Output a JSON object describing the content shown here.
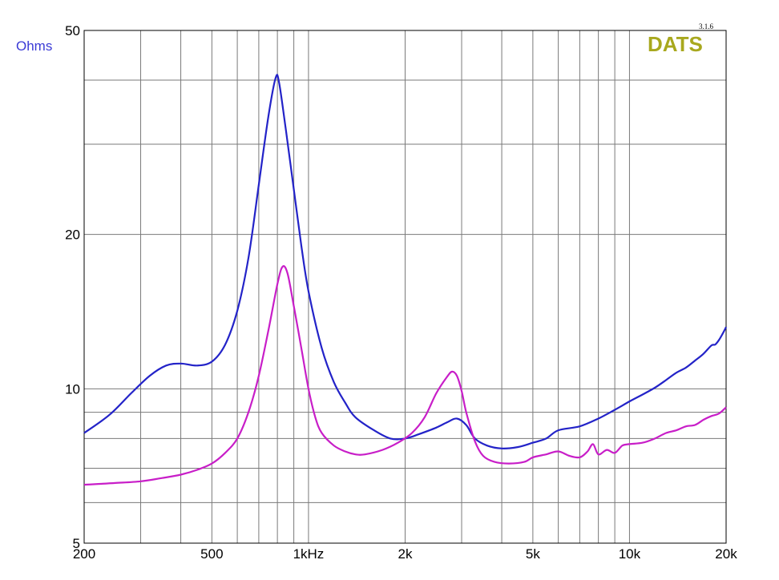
{
  "brand": {
    "name": "DATS",
    "version": "3.1.6"
  },
  "chart_data": {
    "type": "line",
    "title": "",
    "xlabel": "",
    "ylabel": "Ohms",
    "xscale": "log",
    "yscale": "log",
    "xlim": [
      200,
      20000
    ],
    "ylim": [
      5,
      50
    ],
    "grid": true,
    "x_tick_labels": [
      {
        "value": 200,
        "label": "200"
      },
      {
        "value": 500,
        "label": "500"
      },
      {
        "value": 1000,
        "label": "1kHz"
      },
      {
        "value": 2000,
        "label": "2k"
      },
      {
        "value": 5000,
        "label": "5k"
      },
      {
        "value": 10000,
        "label": "10k"
      },
      {
        "value": 20000,
        "label": "20k"
      }
    ],
    "y_tick_labels": [
      {
        "value": 5,
        "label": "5"
      },
      {
        "value": 10,
        "label": "10"
      },
      {
        "value": 20,
        "label": "20"
      },
      {
        "value": 50,
        "label": "50"
      }
    ],
    "series": [
      {
        "color": "#2323c8",
        "points": [
          [
            200,
            8.2
          ],
          [
            240,
            8.9
          ],
          [
            280,
            9.8
          ],
          [
            320,
            10.6
          ],
          [
            360,
            11.1
          ],
          [
            400,
            11.2
          ],
          [
            450,
            11.1
          ],
          [
            500,
            11.3
          ],
          [
            550,
            12.2
          ],
          [
            600,
            14.2
          ],
          [
            650,
            18.0
          ],
          [
            700,
            25.0
          ],
          [
            750,
            34.0
          ],
          [
            790,
            40.4
          ],
          [
            810,
            39.5
          ],
          [
            850,
            32.0
          ],
          [
            900,
            24.5
          ],
          [
            950,
            19.0
          ],
          [
            1000,
            15.5
          ],
          [
            1100,
            12.0
          ],
          [
            1200,
            10.3
          ],
          [
            1300,
            9.4
          ],
          [
            1400,
            8.8
          ],
          [
            1600,
            8.3
          ],
          [
            1800,
            8.0
          ],
          [
            2000,
            8.0
          ],
          [
            2200,
            8.15
          ],
          [
            2500,
            8.4
          ],
          [
            2700,
            8.6
          ],
          [
            2900,
            8.75
          ],
          [
            3100,
            8.5
          ],
          [
            3300,
            8.0
          ],
          [
            3600,
            7.75
          ],
          [
            4000,
            7.65
          ],
          [
            4500,
            7.7
          ],
          [
            5000,
            7.85
          ],
          [
            5500,
            8.0
          ],
          [
            6000,
            8.3
          ],
          [
            7000,
            8.45
          ],
          [
            8000,
            8.75
          ],
          [
            9000,
            9.1
          ],
          [
            10000,
            9.45
          ],
          [
            11000,
            9.75
          ],
          [
            12000,
            10.05
          ],
          [
            13000,
            10.4
          ],
          [
            14000,
            10.75
          ],
          [
            15000,
            11.0
          ],
          [
            16000,
            11.35
          ],
          [
            17000,
            11.7
          ],
          [
            18000,
            12.15
          ],
          [
            18500,
            12.2
          ],
          [
            19000,
            12.45
          ],
          [
            19500,
            12.8
          ],
          [
            20000,
            13.2
          ]
        ]
      },
      {
        "color": "#c81ec8",
        "points": [
          [
            200,
            6.5
          ],
          [
            250,
            6.55
          ],
          [
            300,
            6.6
          ],
          [
            350,
            6.7
          ],
          [
            400,
            6.8
          ],
          [
            450,
            6.95
          ],
          [
            500,
            7.15
          ],
          [
            550,
            7.5
          ],
          [
            600,
            8.0
          ],
          [
            650,
            9.0
          ],
          [
            700,
            10.6
          ],
          [
            750,
            13.0
          ],
          [
            800,
            16.0
          ],
          [
            830,
            17.3
          ],
          [
            860,
            16.8
          ],
          [
            900,
            14.5
          ],
          [
            950,
            12.0
          ],
          [
            1000,
            10.0
          ],
          [
            1050,
            8.8
          ],
          [
            1100,
            8.2
          ],
          [
            1200,
            7.75
          ],
          [
            1300,
            7.55
          ],
          [
            1400,
            7.45
          ],
          [
            1500,
            7.45
          ],
          [
            1700,
            7.6
          ],
          [
            1900,
            7.85
          ],
          [
            2100,
            8.2
          ],
          [
            2300,
            8.8
          ],
          [
            2500,
            9.8
          ],
          [
            2700,
            10.55
          ],
          [
            2800,
            10.8
          ],
          [
            2900,
            10.6
          ],
          [
            3000,
            9.9
          ],
          [
            3100,
            9.0
          ],
          [
            3300,
            7.9
          ],
          [
            3500,
            7.4
          ],
          [
            3800,
            7.2
          ],
          [
            4200,
            7.15
          ],
          [
            4700,
            7.2
          ],
          [
            5000,
            7.35
          ],
          [
            5500,
            7.45
          ],
          [
            6000,
            7.55
          ],
          [
            6500,
            7.4
          ],
          [
            7000,
            7.35
          ],
          [
            7400,
            7.55
          ],
          [
            7700,
            7.8
          ],
          [
            8000,
            7.45
          ],
          [
            8500,
            7.6
          ],
          [
            9000,
            7.5
          ],
          [
            9500,
            7.75
          ],
          [
            10000,
            7.8
          ],
          [
            11000,
            7.85
          ],
          [
            12000,
            8.0
          ],
          [
            13000,
            8.2
          ],
          [
            14000,
            8.3
          ],
          [
            15000,
            8.45
          ],
          [
            16000,
            8.5
          ],
          [
            17000,
            8.7
          ],
          [
            18000,
            8.85
          ],
          [
            19000,
            8.95
          ],
          [
            20000,
            9.2
          ]
        ]
      }
    ]
  }
}
